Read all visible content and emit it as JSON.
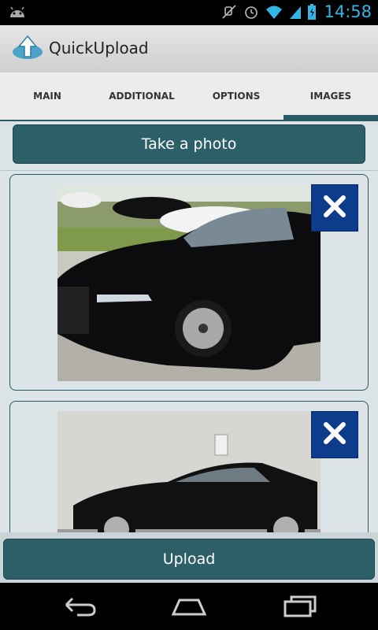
{
  "status_bar": {
    "time": "14:58",
    "icons": [
      "android-icon",
      "mute-icon",
      "alarm-icon",
      "wifi-icon",
      "signal-icon",
      "battery-icon"
    ]
  },
  "app": {
    "title": "QuickUpload"
  },
  "tabs": [
    {
      "label": "MAIN",
      "active": false
    },
    {
      "label": "ADDITIONAL",
      "active": false
    },
    {
      "label": "OPTIONS",
      "active": false
    },
    {
      "label": "IMAGES",
      "active": true
    }
  ],
  "main": {
    "take_photo_label": "Take a photo",
    "images": [
      {
        "description": "car-photo-front",
        "remove_icon": "close-icon"
      },
      {
        "description": "car-photo-side",
        "remove_icon": "close-icon"
      }
    ]
  },
  "footer": {
    "upload_label": "Upload"
  },
  "nav_bar": {
    "buttons": [
      "back-icon",
      "home-icon",
      "recents-icon"
    ]
  },
  "colors": {
    "accent": "#2d5f69",
    "status_text": "#33b5e5",
    "remove_button": "#0d3c8c"
  }
}
